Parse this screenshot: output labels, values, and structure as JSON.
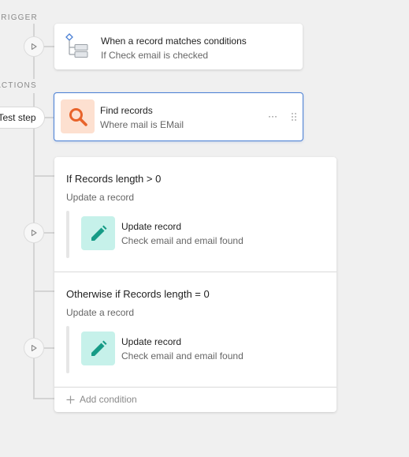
{
  "sections": {
    "trigger_label": "TRIGGER",
    "actions_label": "ACTIONS"
  },
  "trigger": {
    "title": "When a record matches conditions",
    "subtitle": "If Check email is checked",
    "icon": "flow-tree-icon"
  },
  "test_step": {
    "label": "Test step"
  },
  "find_records": {
    "title": "Find records",
    "subtitle": "Where mail is EMail",
    "icon": "search-icon",
    "more_label": "···"
  },
  "branches": [
    {
      "condition": "If Records length > 0",
      "description": "Update a record",
      "action": {
        "title": "Update record",
        "subtitle": "Check email and email found",
        "icon": "pencil-icon"
      }
    },
    {
      "condition": "Otherwise if Records length = 0",
      "description": "Update a record",
      "action": {
        "title": "Update record",
        "subtitle": "Check email and email found",
        "icon": "pencil-icon"
      }
    }
  ],
  "add_condition": {
    "label": "Add condition"
  },
  "colors": {
    "find_icon_bg": "#fde0d0",
    "find_icon_fg": "#e8632a",
    "update_icon_bg": "#c6f1ea",
    "update_icon_fg": "#169b86",
    "selected_border": "#4a7fd4"
  }
}
